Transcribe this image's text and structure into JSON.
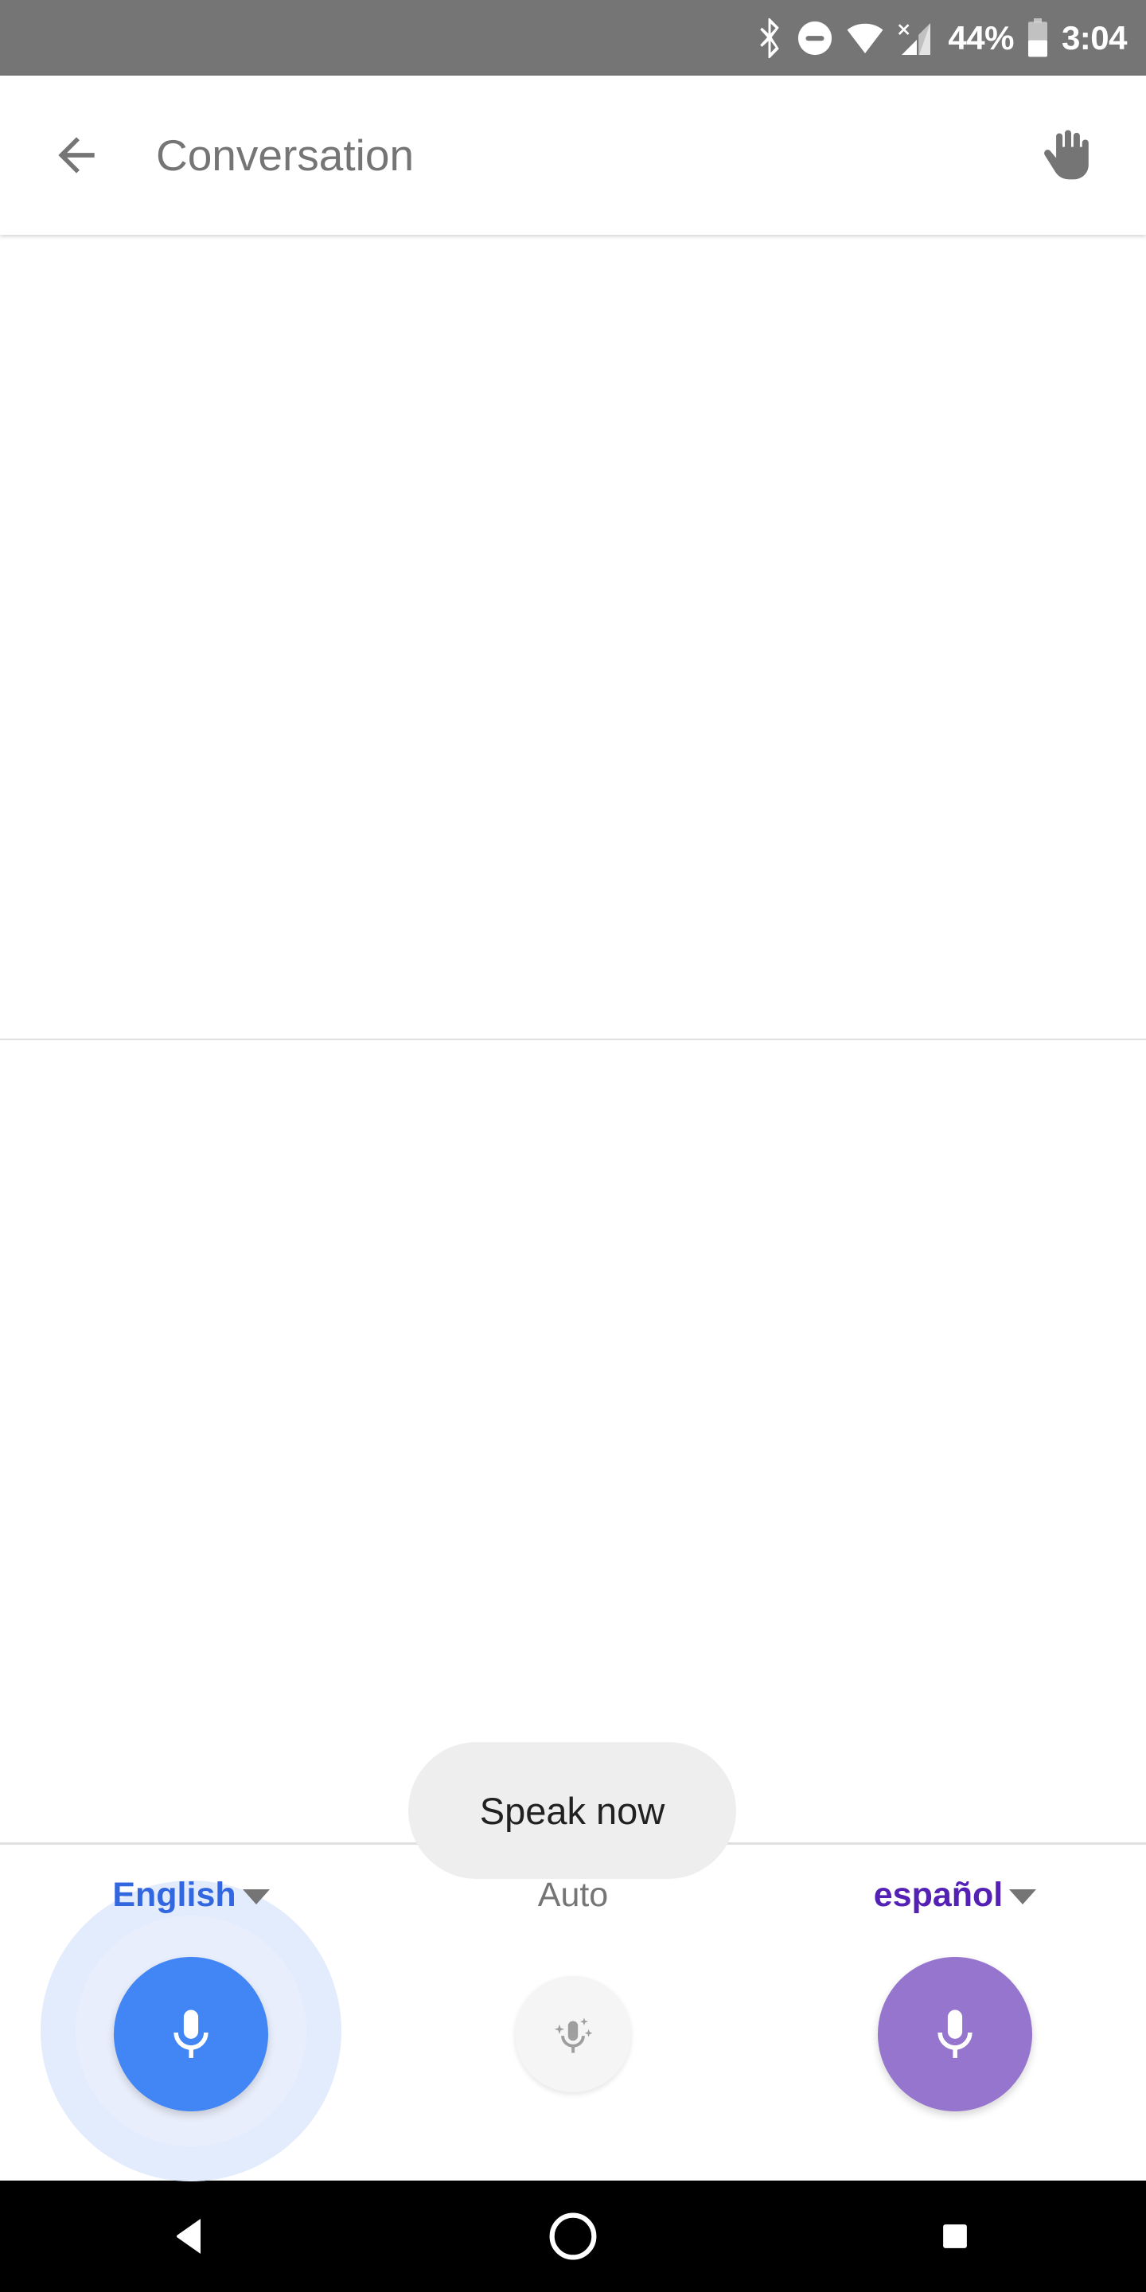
{
  "status_bar": {
    "background": "#757575",
    "icons": [
      "bluetooth-icon",
      "do-not-disturb-icon",
      "wifi-icon",
      "cell-signal-no-service-icon",
      "battery-icon"
    ],
    "battery_percent": "44%",
    "time": "3:04"
  },
  "app_bar": {
    "back_icon": "back-arrow-icon",
    "title": "Conversation",
    "action_icon": "raised-hand-icon"
  },
  "conversation": {
    "top_pane_text": "",
    "bottom_pane_text": ""
  },
  "prompt": {
    "chip_label": "Speak now",
    "chip_background": "#eeeeee"
  },
  "controls": {
    "left": {
      "language": "English",
      "caret": "chevron-down-icon",
      "mic_icon": "microphone-icon",
      "color": "#4285f4",
      "label_color": "#3367e0",
      "listening": true
    },
    "center": {
      "language": "Auto",
      "mic_icon": "microphone-auto-detect-icon",
      "color": "#f5f5f5",
      "label_color": "#757575",
      "listening": false
    },
    "right": {
      "language": "español",
      "caret": "chevron-down-icon",
      "mic_icon": "microphone-icon",
      "color": "#9575cd",
      "label_color": "#5521b5",
      "listening": false
    }
  },
  "nav_bar": {
    "background": "#000000",
    "buttons": [
      "back-nav-icon",
      "home-nav-icon",
      "recents-nav-icon"
    ]
  }
}
